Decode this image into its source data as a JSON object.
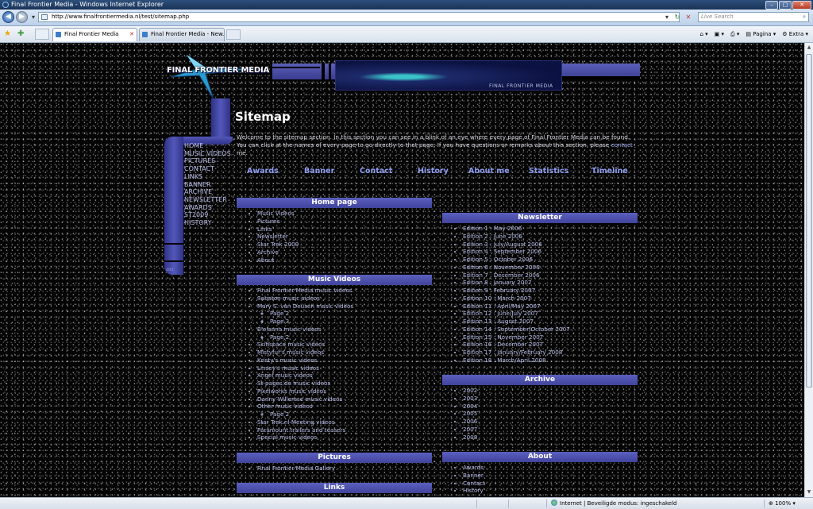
{
  "browser": {
    "window_title": "Final Frontier Media - Windows Internet Explorer",
    "url": "http://www.finalfrontiermedia.nl/test/sitemap.php",
    "search_placeholder": "Live Search",
    "tabs": [
      {
        "label": "Final Frontier Media"
      },
      {
        "label": "Final Frontier Media - New..."
      }
    ],
    "toolbar": {
      "page_label": "Pagina",
      "extra_label": "Extra"
    },
    "status": {
      "zone": "Internet | Beveiligde modus: ingeschakeld",
      "zoom": "100%"
    }
  },
  "site": {
    "logo": "FINAL FRONTIER MEDIA",
    "banner_caption": "FINAL FRONTIER MEDIA",
    "sidebar_nav": [
      "HOME",
      "MUSIC VIDEOS",
      "PICTURES",
      "CONTACT",
      "LINKS",
      "BANNER",
      "ARCHIVE",
      "NEWSLETTER",
      "AWARDS",
      "ST2009",
      "HISTORY"
    ],
    "sidebar_small": "ddd"
  },
  "page": {
    "title": "Sitemap",
    "intro_before": "Welcome to the sitemap section. In this section you can see in a blink of an eye where every page of Final Frontier Media can be found. You can click at the names of every page to go directly to that page. If you have questions or remarks about this section, please ",
    "intro_link": "contact",
    "intro_after": " me.",
    "top_nav": [
      "Awards",
      "Banner",
      "Contact",
      "History",
      "About me",
      "Statistics",
      "Timeline"
    ]
  },
  "sections": {
    "home": {
      "title": "Home page",
      "items": [
        "Music Videos",
        "Pictures",
        "Links",
        "Newsletter",
        "Star Trek 2009",
        "Archive",
        "About"
      ]
    },
    "music_videos": {
      "title": "Music Videos",
      "items": [
        {
          "label": "Final Frontier Media music videos",
          "sub": false
        },
        {
          "label": "Sabaton music videos",
          "sub": false
        },
        {
          "label": "Mary S. van Deusen music videos",
          "sub": false
        },
        {
          "label": "Page 2",
          "sub": true
        },
        {
          "label": "Page 3",
          "sub": true
        },
        {
          "label": "B'elanna music videos",
          "sub": false
        },
        {
          "label": "Page 2",
          "sub": true
        },
        {
          "label": "Scifispace music videos",
          "sub": false
        },
        {
          "label": "Mistyfur's music videos",
          "sub": false
        },
        {
          "label": "Kristy's music videos",
          "sub": false
        },
        {
          "label": "Linsey's music videos",
          "sub": false
        },
        {
          "label": "Angel music videos",
          "sub": false
        },
        {
          "label": "St-pages.de music videos",
          "sub": false
        },
        {
          "label": "Pixelworks music videos",
          "sub": false
        },
        {
          "label": "Danny Willemse music videos",
          "sub": false
        },
        {
          "label": "Other music videos",
          "sub": false
        },
        {
          "label": "Page 2",
          "sub": true
        },
        {
          "label": "Star Trek.nl Meeting videos",
          "sub": false
        },
        {
          "label": "Paramount trailers and teasers",
          "sub": false
        },
        {
          "label": "Special music videos",
          "sub": false
        }
      ]
    },
    "pictures": {
      "title": "Pictures",
      "items": [
        "Final Frontier Media Gallery"
      ]
    },
    "links": {
      "title": "Links"
    },
    "newsletter": {
      "title": "Newsletter",
      "items": [
        "Edition 1 : May 2006",
        "Edition 2 : June 2006",
        "Edition 3 : July/August 2006",
        "Edition 4 : September 2006",
        "Edition 5 : October 2006",
        "Edition 6 : November 2006",
        "Edition 7 : December 2006",
        "Edition 8 : January 2007",
        "Edition 9 : February 2007",
        "Edition 10 : March 2007",
        "Edition 11 : April/May 2007",
        "Edition 12 : June/July 2007",
        "Edition 13 : August 2007",
        "Edition 14 : September/October 2007",
        "Edition 15 : November 2007",
        "Edition 16 : December 2007",
        "Edition 17 : January/February 2008",
        "Edition 18 : March/April 2008"
      ]
    },
    "archive": {
      "title": "Archive",
      "items": [
        "2002",
        "2003",
        "2004",
        "2005",
        "2006",
        "2007",
        "2008"
      ]
    },
    "about": {
      "title": "About",
      "items": [
        "Awards",
        "Banner",
        "Contact",
        "History"
      ]
    }
  },
  "colors": {
    "accent": "#4a4fae",
    "link": "#b8bde8",
    "nav": "#8e9cf0",
    "background": "#050505"
  }
}
